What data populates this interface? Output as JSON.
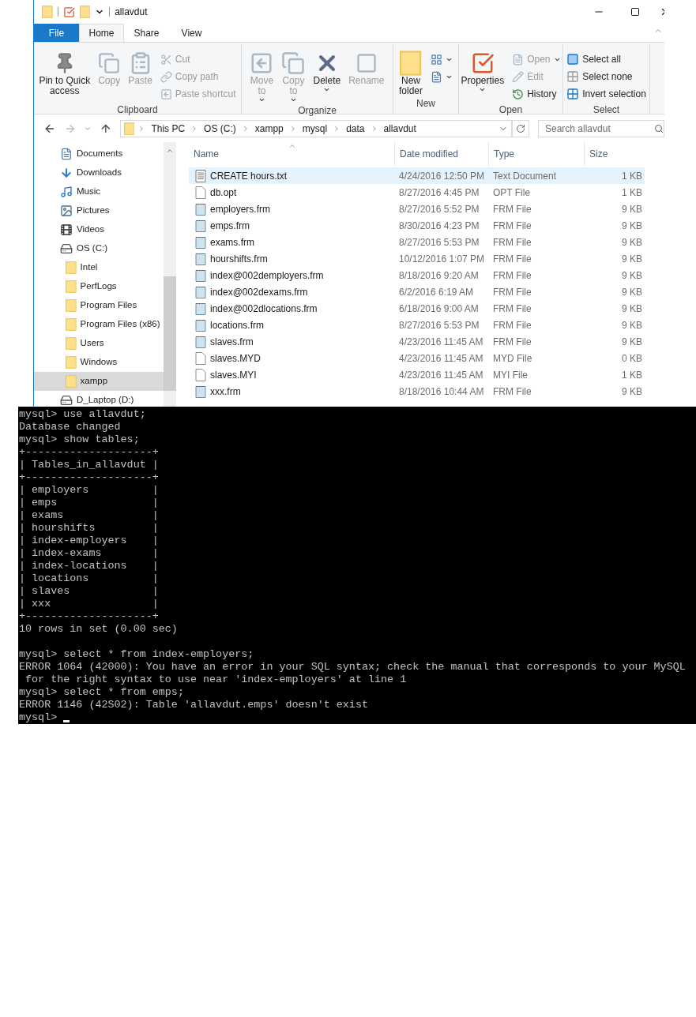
{
  "explorer": {
    "title": "allavdut",
    "tabs": [
      {
        "label": "File",
        "kind": "file",
        "selected": false
      },
      {
        "label": "Home",
        "kind": "tab",
        "selected": true
      },
      {
        "label": "Share",
        "kind": "tab",
        "selected": false
      },
      {
        "label": "View",
        "kind": "tab",
        "selected": false
      }
    ],
    "ribbon": {
      "groups": [
        {
          "label": "Clipboard",
          "commands": [
            {
              "label": [
                "Pin to Quick",
                "access"
              ],
              "kind": "large",
              "disabled": false,
              "menu": false
            },
            {
              "label": [
                "Copy"
              ],
              "kind": "large",
              "disabled": true,
              "menu": false
            },
            {
              "label": [
                "Paste"
              ],
              "kind": "large",
              "disabled": true,
              "menu": false
            },
            {
              "label": [
                "Cut"
              ],
              "kind": "small",
              "disabled": true,
              "menu": false
            },
            {
              "label": [
                "Copy path"
              ],
              "kind": "small",
              "disabled": true,
              "menu": false
            },
            {
              "label": [
                "Paste shortcut"
              ],
              "kind": "small",
              "disabled": true,
              "menu": false
            }
          ]
        },
        {
          "label": "Organize",
          "commands": [
            {
              "label": [
                "Move",
                "to"
              ],
              "kind": "large",
              "disabled": true,
              "menu": true
            },
            {
              "label": [
                "Copy",
                "to"
              ],
              "kind": "large",
              "disabled": true,
              "menu": true
            },
            {
              "label": [
                "Delete"
              ],
              "kind": "large",
              "disabled": false,
              "menu": true
            },
            {
              "label": [
                "Rename"
              ],
              "kind": "large",
              "disabled": true,
              "menu": false
            }
          ]
        },
        {
          "label": "New",
          "commands": [
            {
              "label": [
                "New",
                "folder"
              ],
              "kind": "large",
              "disabled": false,
              "menu": false
            },
            {
              "kind": "small",
              "disabled": false,
              "menu": true
            },
            {
              "kind": "small",
              "disabled": false,
              "menu": true
            }
          ]
        },
        {
          "label": "Open",
          "commands": [
            {
              "label": [
                "Properties"
              ],
              "kind": "large",
              "disabled": false,
              "menu": true
            },
            {
              "label": [
                "Open"
              ],
              "kind": "small",
              "disabled": true,
              "menu": true
            },
            {
              "label": [
                "Edit"
              ],
              "kind": "small",
              "disabled": true,
              "menu": false
            },
            {
              "label": [
                "History"
              ],
              "kind": "small",
              "disabled": false,
              "menu": false
            }
          ]
        },
        {
          "label": "Select",
          "commands": [
            {
              "label": [
                "Select all"
              ],
              "kind": "small",
              "disabled": false,
              "menu": false
            },
            {
              "label": [
                "Select none"
              ],
              "kind": "small",
              "disabled": false,
              "menu": false
            },
            {
              "label": [
                "Invert selection"
              ],
              "kind": "small",
              "disabled": false,
              "menu": false
            }
          ]
        }
      ]
    },
    "breadcrumb": [
      "This PC",
      "OS (C:)",
      "xampp",
      "mysql",
      "data",
      "allavdut"
    ],
    "search": {
      "placeholder": "Search allavdut"
    },
    "navigation": [
      {
        "label": "Documents",
        "selected": false
      },
      {
        "label": "Downloads",
        "selected": false
      },
      {
        "label": "Music",
        "selected": false
      },
      {
        "label": "Pictures",
        "selected": false
      },
      {
        "label": "Videos",
        "selected": false
      },
      {
        "label": "OS (C:)",
        "selected": false,
        "children": [
          {
            "label": "Intel",
            "selected": false
          },
          {
            "label": "PerfLogs",
            "selected": false
          },
          {
            "label": "Program Files",
            "selected": false
          },
          {
            "label": "Program Files (x86)",
            "selected": false
          },
          {
            "label": "Users",
            "selected": false
          },
          {
            "label": "Windows",
            "selected": false
          },
          {
            "label": "xampp",
            "selected": true
          }
        ]
      },
      {
        "label": "D_Laptop (D:)",
        "selected": false
      }
    ],
    "columns": [
      {
        "label": "Name",
        "sorted": true
      },
      {
        "label": "Date modified",
        "sorted": false
      },
      {
        "label": "Type",
        "sorted": false
      },
      {
        "label": "Size",
        "sorted": false
      }
    ],
    "files": [
      {
        "name": "CREATE hours.txt",
        "date": "4/24/2016 12:50 PM",
        "type": "Text Document",
        "size": "1 KB",
        "kind": "text",
        "selected": true
      },
      {
        "name": "db.opt",
        "date": "8/27/2016 4:45 PM",
        "type": "OPT File",
        "size": "1 KB",
        "kind": "blank",
        "selected": false
      },
      {
        "name": "employers.frm",
        "date": "8/27/2016 5:52 PM",
        "type": "FRM File",
        "size": "9 KB",
        "kind": "frm",
        "selected": false
      },
      {
        "name": "emps.frm",
        "date": "8/30/2016 4:23 PM",
        "type": "FRM File",
        "size": "9 KB",
        "kind": "frm",
        "selected": false
      },
      {
        "name": "exams.frm",
        "date": "8/27/2016 5:53 PM",
        "type": "FRM File",
        "size": "9 KB",
        "kind": "frm",
        "selected": false
      },
      {
        "name": "hourshifts.frm",
        "date": "10/12/2016 1:07 PM",
        "type": "FRM File",
        "size": "9 KB",
        "kind": "frm",
        "selected": false
      },
      {
        "name": "index@002demployers.frm",
        "date": "8/18/2016 9:20 AM",
        "type": "FRM File",
        "size": "9 KB",
        "kind": "frm",
        "selected": false
      },
      {
        "name": "index@002dexams.frm",
        "date": "6/2/2016 6:19 AM",
        "type": "FRM File",
        "size": "9 KB",
        "kind": "frm",
        "selected": false
      },
      {
        "name": "index@002dlocations.frm",
        "date": "6/18/2016 9:00 AM",
        "type": "FRM File",
        "size": "9 KB",
        "kind": "frm",
        "selected": false
      },
      {
        "name": "locations.frm",
        "date": "8/27/2016 5:53 PM",
        "type": "FRM File",
        "size": "9 KB",
        "kind": "frm",
        "selected": false
      },
      {
        "name": "slaves.frm",
        "date": "4/23/2016 11:45 AM",
        "type": "FRM File",
        "size": "9 KB",
        "kind": "frm",
        "selected": false
      },
      {
        "name": "slaves.MYD",
        "date": "4/23/2016 11:45 AM",
        "type": "MYD File",
        "size": "0 KB",
        "kind": "blank",
        "selected": false
      },
      {
        "name": "slaves.MYI",
        "date": "4/23/2016 11:45 AM",
        "type": "MYI File",
        "size": "1 KB",
        "kind": "blank",
        "selected": false
      },
      {
        "name": "xxx.frm",
        "date": "8/18/2016 10:44 AM",
        "type": "FRM File",
        "size": "9 KB",
        "kind": "frm",
        "selected": false
      }
    ]
  },
  "terminal": {
    "cursor": true,
    "blocks": [
      {
        "lines": [
          "mysql> use allavdut;",
          "Database changed",
          "mysql> show tables;",
          "+--------------------+",
          "| Tables_in_allavdut |",
          "+--------------------+",
          "| employers          |",
          "| emps               |",
          "| exams              |",
          "| hourshifts         |",
          "| index-employers    |",
          "| index-exams        |",
          "| index-locations    |",
          "| locations          |",
          "| slaves             |",
          "| xxx                |",
          "+--------------------+",
          "10 rows in set (0.00 sec)"
        ]
      },
      {
        "lines": [
          "mysql> select * from index-employers;",
          "ERROR 1064 (42000): You have an error in your SQL syntax; check the manual that corresponds to your MySQL",
          " for the right syntax to use near 'index-employers' at line 1",
          "mysql> select * from emps;",
          "ERROR 1146 (42S02): Table 'allavdut.emps' doesn't exist",
          "mysql>"
        ]
      }
    ]
  }
}
